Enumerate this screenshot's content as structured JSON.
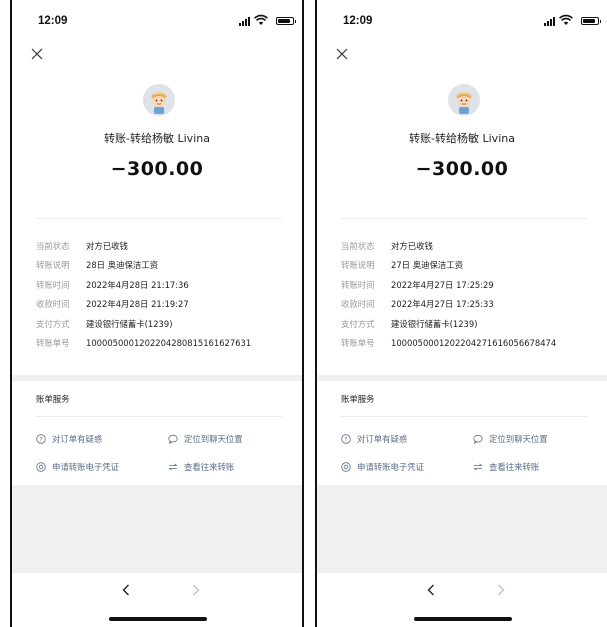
{
  "screens": [
    {
      "time": "12:09",
      "title": "转账-转给杨敏 Livina",
      "amount": "−300.00",
      "details": [
        {
          "label": "当前状态",
          "value": "对方已收钱"
        },
        {
          "label": "转账说明",
          "value": "28日 奥迪保洁工资"
        },
        {
          "label": "转账时间",
          "value": "2022年4月28日 21:17:36"
        },
        {
          "label": "收款时间",
          "value": "2022年4月28日 21:19:27"
        },
        {
          "label": "支付方式",
          "value": "建设银行储蓄卡(1239)"
        },
        {
          "label": "转账单号",
          "value": "1000050001202204280815161627631"
        }
      ],
      "services_title": "账单服务",
      "services": {
        "query": "对订单有疑惑",
        "locate": "定位到聊天位置",
        "receipt": "申请转账电子凭证",
        "history": "查看往来转账"
      }
    },
    {
      "time": "12:09",
      "title": "转账-转给杨敏 Livina",
      "amount": "−300.00",
      "details": [
        {
          "label": "当前状态",
          "value": "对方已收钱"
        },
        {
          "label": "转账说明",
          "value": "27日 奥迪保洁工资"
        },
        {
          "label": "转账时间",
          "value": "2022年4月27日 17:25:29"
        },
        {
          "label": "收款时间",
          "value": "2022年4月27日 17:25:33"
        },
        {
          "label": "支付方式",
          "value": "建设银行储蓄卡(1239)"
        },
        {
          "label": "转账单号",
          "value": "1000050001202204271616056678474"
        }
      ],
      "services_title": "账单服务",
      "services": {
        "query": "对订单有疑惑",
        "locate": "定位到聊天位置",
        "receipt": "申请转账电子凭证",
        "history": "查看往来转账"
      }
    }
  ],
  "icons": {
    "close": "close-icon",
    "avatar": "avatar",
    "query": "question-circle-icon",
    "locate": "chat-bubble-icon",
    "receipt": "receipt-circle-icon",
    "history": "transfer-arrows-icon",
    "back": "chevron-left-icon",
    "forward": "chevron-right-icon"
  },
  "colors": {
    "service_link": "#5a6d88",
    "label_gray": "#9a9a9a",
    "band_gray": "#f1f1f1"
  }
}
